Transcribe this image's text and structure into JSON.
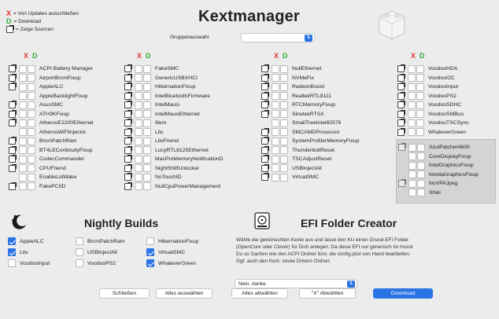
{
  "app": {
    "title": "Kextmanager",
    "group_label": "Gruppenauswahl",
    "group_value": ""
  },
  "legend": {
    "x_mark": "X",
    "x_text": "= Von Updates ausschließen",
    "d_mark": "D",
    "d_text": "= Download",
    "src_text": "= Zeige Sourcen"
  },
  "column_header": {
    "x": "X",
    "d": "D"
  },
  "columns": [
    {
      "items": [
        {
          "name": "ACPI Battery Manager",
          "icon": true
        },
        {
          "name": "AirportBrcmFixup",
          "icon": true
        },
        {
          "name": "AppleALC",
          "icon": true
        },
        {
          "name": "AppleBacklightFixup",
          "icon": false
        },
        {
          "name": "AsusSMC",
          "icon": true
        },
        {
          "name": "ATH9KFixup",
          "icon": true
        },
        {
          "name": "AtherosE2200Ethernet",
          "icon": true
        },
        {
          "name": "AtherosWiFiInjector",
          "icon": false
        },
        {
          "name": "BrcmPatchRam",
          "icon": true
        },
        {
          "name": "BT4LEContinuityFixup",
          "icon": true
        },
        {
          "name": "CodecCommander",
          "icon": true
        },
        {
          "name": "CPUFriend",
          "icon": true
        },
        {
          "name": "EnableLidWake",
          "icon": false
        },
        {
          "name": "FakePCIID",
          "icon": true
        }
      ]
    },
    {
      "items": [
        {
          "name": "FakeSMC",
          "icon": true
        },
        {
          "name": "GenericUSBXHCI",
          "icon": true
        },
        {
          "name": "HibernationFixup",
          "icon": true
        },
        {
          "name": "IntelBluetoothFirmware",
          "icon": true
        },
        {
          "name": "IntelMausi",
          "icon": true
        },
        {
          "name": "IntelMausiEthernet",
          "icon": true
        },
        {
          "name": "Illem",
          "icon": true
        },
        {
          "name": "Lilu",
          "icon": true
        },
        {
          "name": "LiluFriend",
          "icon": true
        },
        {
          "name": "LucyRTL8125Ethernet",
          "icon": true
        },
        {
          "name": "MacProMemoryNotificationD",
          "icon": true
        },
        {
          "name": "NightShiftUnlocker",
          "icon": true
        },
        {
          "name": "NoTouchID",
          "icon": true
        },
        {
          "name": "NullCpuPowerManagement",
          "icon": true
        }
      ]
    },
    {
      "items": [
        {
          "name": "NullEthernet",
          "icon": true
        },
        {
          "name": "NVMeFix",
          "icon": true
        },
        {
          "name": "RadeonBoost",
          "icon": true
        },
        {
          "name": "RealtekRTL8111",
          "icon": true
        },
        {
          "name": "RTCMemoryFixup",
          "icon": true
        },
        {
          "name": "SinetekRTSX",
          "icon": true
        },
        {
          "name": "SmallTreeIntel82576",
          "icon": false
        },
        {
          "name": "SMCAMDProcessor",
          "icon": true
        },
        {
          "name": "SystemProfilerMemoryFixup",
          "icon": true
        },
        {
          "name": "ThunderboltReset",
          "icon": true
        },
        {
          "name": "TSCAdjustReset",
          "icon": true
        },
        {
          "name": "USBInjectAll",
          "icon": true
        },
        {
          "name": "VirtualSMC",
          "icon": true
        }
      ]
    },
    {
      "items": [
        {
          "name": "VoodooHDA",
          "icon": true
        },
        {
          "name": "VoodooI2C",
          "icon": true
        },
        {
          "name": "VoodooInput",
          "icon": true
        },
        {
          "name": "VoodooPS2",
          "icon": true
        },
        {
          "name": "VoodooSDHC",
          "icon": true
        },
        {
          "name": "VoodooSMBus",
          "icon": true
        },
        {
          "name": "VoodooTSCSync",
          "icon": true
        },
        {
          "name": "WhateverGreen",
          "icon": true
        }
      ]
    }
  ],
  "grey_group": [
    {
      "name": "AzulPatcher4600",
      "icon": true
    },
    {
      "name": "CoreDisplayFixup",
      "icon": false
    },
    {
      "name": "IntelGraphicsFixup",
      "icon": false
    },
    {
      "name": "NvidiaGraphicsFixup",
      "icon": false
    },
    {
      "name": "NoVPAJpeg",
      "icon": true
    },
    {
      "name": "Shiki",
      "icon": false
    }
  ],
  "nightly": {
    "title": "Nightly Builds",
    "items": [
      {
        "name": "AppleALC",
        "checked": true
      },
      {
        "name": "BrcmPatchRam",
        "checked": false
      },
      {
        "name": "HibernationFixup",
        "checked": false
      },
      {
        "name": "Lilu",
        "checked": true
      },
      {
        "name": "USBInjectAll",
        "checked": false
      },
      {
        "name": "VirtualSMC",
        "checked": true
      },
      {
        "name": "VoodooInput",
        "checked": false
      },
      {
        "name": "VoodooPS2",
        "checked": false
      },
      {
        "name": "WhateverGreen",
        "checked": true
      }
    ]
  },
  "efi": {
    "title": "EFI Folder Creator",
    "desc1": "Wähle die gewünschten Kexte aus und lasse den KU einen Grund-EFI Folder",
    "desc2": "(OpenCore oder Clover) für Dich anlegen. Da diese EFI nur generisch ist musst",
    "desc3": "Du so Sachen wie den ACPI Ordner bzw. die config.plist von Hand bearbeiten.",
    "desc4": "Ggf. auch den Kext- sowie Drivers Ordner.",
    "select_value": "Nein, danke"
  },
  "buttons": {
    "close": "Schließen",
    "select_all": "Alles auswählen",
    "deselect_all": "Alles abwählen",
    "x_deselect": "\"X\" Abwählen",
    "download": "Download"
  },
  "colors": {
    "accent": "#2a74e6",
    "x_red": "#e0302a",
    "d_green": "#2eae3a"
  }
}
